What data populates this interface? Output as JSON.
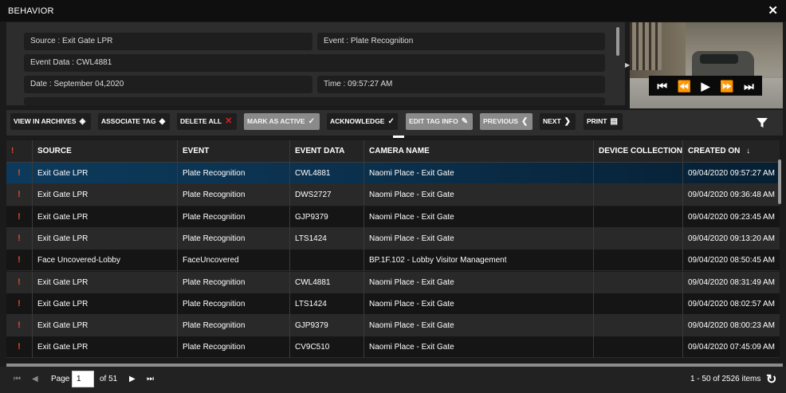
{
  "window": {
    "title": "BEHAVIOR",
    "close_icon": "close-icon"
  },
  "details": {
    "source": "Source  : Exit Gate LPR",
    "event": "Event  : Plate Recognition",
    "event_data": "Event Data  : CWL4881",
    "date": "Date  : September 04,2020",
    "time": "Time  : 09:57:27 AM"
  },
  "video_controls": [
    "skip-back-icon",
    "rewind-icon",
    "play-icon",
    "fast-forward-icon",
    "skip-forward-icon"
  ],
  "toolbar": {
    "view_archives": "VIEW IN ARCHIVES",
    "associate_tag": "ASSOCIATE TAG",
    "delete_all": "DELETE ALL",
    "mark_active": "MARK AS ACTIVE",
    "acknowledge": "ACKNOWLEDGE",
    "edit_tag_info": "EDIT TAG INFO",
    "previous": "PREVIOUS",
    "next": "NEXT",
    "print": "PRINT",
    "filter_icon": "filter-icon"
  },
  "grid": {
    "columns": {
      "source": "SOURCE",
      "event": "EVENT",
      "event_data": "EVENT DATA",
      "camera_name": "CAMERA NAME",
      "device_collection": "DEVICE COLLECTION",
      "created_on": "CREATED ON"
    },
    "sort_indicator": "↓",
    "flag_glyph": "!",
    "rows": [
      {
        "source": "Exit Gate LPR",
        "event": "Plate Recognition",
        "event_data": "CWL4881",
        "camera": "Naomi Place - Exit Gate",
        "device_collection": "",
        "created_on": "09/04/2020 09:57:27 AM"
      },
      {
        "source": "Exit Gate LPR",
        "event": "Plate Recognition",
        "event_data": "DWS2727",
        "camera": "Naomi Place - Exit Gate",
        "device_collection": "",
        "created_on": "09/04/2020 09:36:48 AM"
      },
      {
        "source": "Exit Gate LPR",
        "event": "Plate Recognition",
        "event_data": "GJP9379",
        "camera": "Naomi Place - Exit Gate",
        "device_collection": "",
        "created_on": "09/04/2020 09:23:45 AM"
      },
      {
        "source": "Exit Gate LPR",
        "event": "Plate Recognition",
        "event_data": "LTS1424",
        "camera": "Naomi Place - Exit Gate",
        "device_collection": "",
        "created_on": "09/04/2020 09:13:20 AM"
      },
      {
        "source": "Face Uncovered-Lobby",
        "event": "FaceUncovered",
        "event_data": "",
        "camera": "BP.1F.102 - Lobby Visitor Management",
        "device_collection": "",
        "created_on": "09/04/2020 08:50:45 AM"
      },
      {
        "source": "Exit Gate LPR",
        "event": "Plate Recognition",
        "event_data": "CWL4881",
        "camera": "Naomi Place - Exit Gate",
        "device_collection": "",
        "created_on": "09/04/2020 08:31:49 AM"
      },
      {
        "source": "Exit Gate LPR",
        "event": "Plate Recognition",
        "event_data": "LTS1424",
        "camera": "Naomi Place - Exit Gate",
        "device_collection": "",
        "created_on": "09/04/2020 08:02:57 AM"
      },
      {
        "source": "Exit Gate LPR",
        "event": "Plate Recognition",
        "event_data": "GJP9379",
        "camera": "Naomi Place - Exit Gate",
        "device_collection": "",
        "created_on": "09/04/2020 08:00:23 AM"
      },
      {
        "source": "Exit Gate LPR",
        "event": "Plate Recognition",
        "event_data": "CV9C510",
        "camera": "Naomi Place - Exit Gate",
        "device_collection": "",
        "created_on": "09/04/2020 07:45:09 AM"
      }
    ]
  },
  "pagination": {
    "page_label": "Page",
    "page_value": "1",
    "of_label": "of 51",
    "items_info": "1 - 50 of 2526 items"
  }
}
